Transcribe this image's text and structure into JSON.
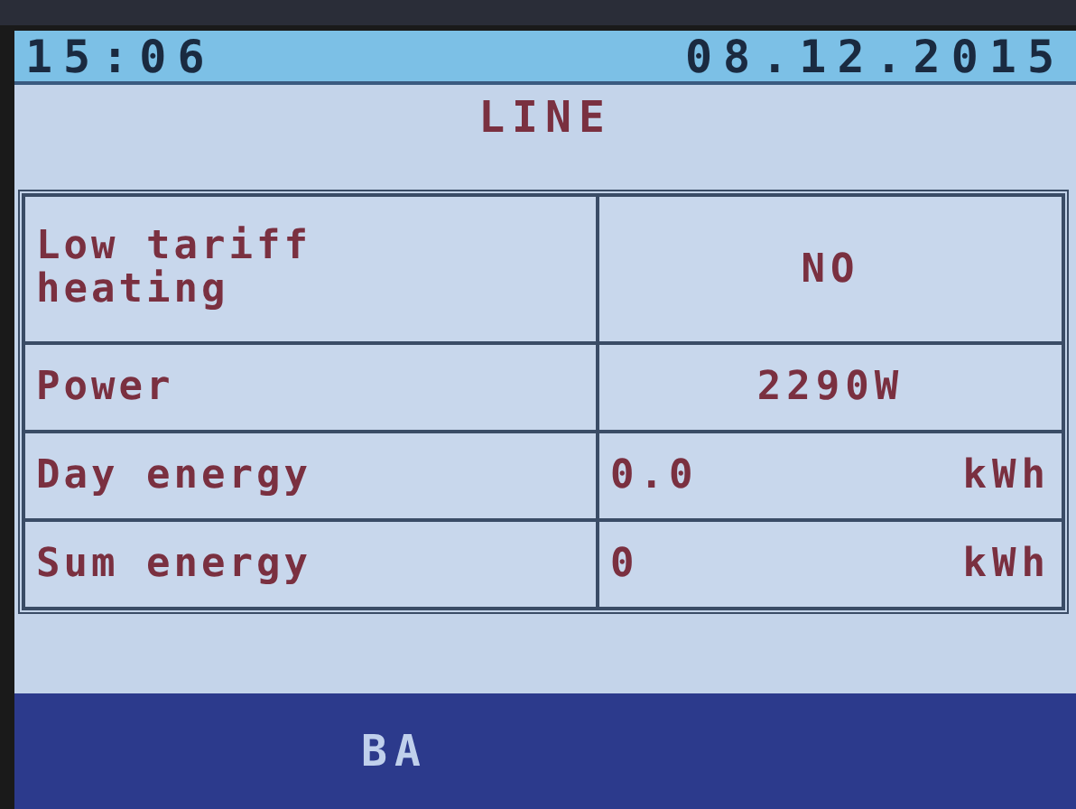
{
  "status_bar": {
    "time": "15:06",
    "date": "08.12.2015"
  },
  "title": "LINE",
  "table": {
    "rows": [
      {
        "label": "Low tariff heating",
        "kind": "centered",
        "value": "NO"
      },
      {
        "label": "Power",
        "kind": "centered",
        "value": "2290W"
      },
      {
        "label": "Day energy",
        "kind": "split",
        "value": "0.0",
        "unit": "kWh"
      },
      {
        "label": "Sum energy",
        "kind": "split",
        "value": "0",
        "unit": "kWh"
      }
    ]
  },
  "footer": {
    "button": "BA"
  }
}
